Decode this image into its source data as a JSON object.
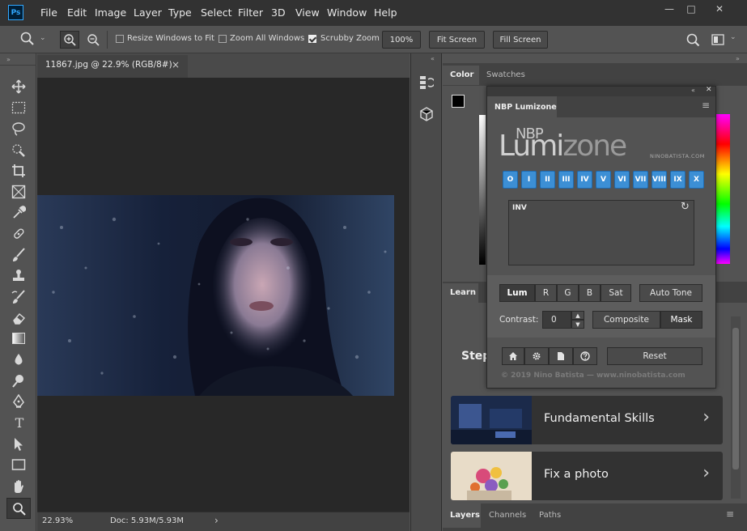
{
  "app": {
    "logo": "Ps"
  },
  "menu": [
    "File",
    "Edit",
    "Image",
    "Layer",
    "Type",
    "Select",
    "Filter",
    "3D",
    "View",
    "Window",
    "Help"
  ],
  "window_controls": {
    "minimize": "—",
    "maximize": "□",
    "close": "✕"
  },
  "options_bar": {
    "resize_windows": {
      "label": "Resize Windows to Fit",
      "checked": false
    },
    "zoom_all": {
      "label": "Zoom All Windows",
      "checked": false
    },
    "scrubby_zoom": {
      "label": "Scrubby Zoom",
      "checked": true
    },
    "zoom_value": "100%",
    "fit_screen": "Fit Screen",
    "fill_screen": "Fill Screen"
  },
  "document": {
    "tab_title": "11867.jpg @ 22.9% (RGB/8#)",
    "close": "×",
    "zoom_status": "22.93%",
    "doc_size": "Doc: 5.93M/5.93M",
    "status_arrow": "›"
  },
  "right_panel": {
    "tabs": [
      "Color",
      "Swatches"
    ],
    "learn_tab": "Learn",
    "steps_text": "Step",
    "cards": [
      {
        "title": "Fundamental Skills",
        "chevron": "›"
      },
      {
        "title": "Fix a photo",
        "chevron": "›"
      }
    ],
    "bottom_tabs": [
      "Layers",
      "Channels",
      "Paths"
    ]
  },
  "lumizone": {
    "panel_title": "NBP Lumizone",
    "logo_small": "NBP",
    "logo_light": "Lumi",
    "logo_zone": "zone",
    "site_small": "NINOBATISTA.COM",
    "zones": [
      "O",
      "I",
      "II",
      "III",
      "IV",
      "V",
      "VI",
      "VII",
      "VIII",
      "IX",
      "X"
    ],
    "list_label": "INV",
    "mode_buttons": [
      "Lum",
      "R",
      "G",
      "B",
      "Sat"
    ],
    "auto_tone": "Auto Tone",
    "contrast_label": "Contrast:",
    "contrast_value": "0",
    "composite": "Composite",
    "mask": "Mask",
    "reset": "Reset",
    "footer": "© 2019 Nino Batista — www.ninobatista.com"
  },
  "colors": {
    "accent_blue": "#3c8fd5",
    "menubar": "#323232",
    "panel": "#535353",
    "canvas": "#282828"
  }
}
